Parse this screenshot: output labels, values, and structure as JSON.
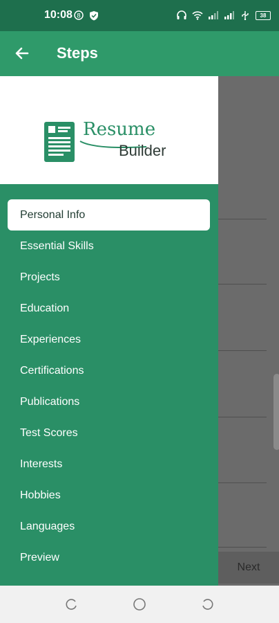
{
  "status": {
    "time": "10:08",
    "battery": "38"
  },
  "appbar": {
    "title": "Steps"
  },
  "drawer": {
    "logo": {
      "word1": "Resume",
      "word2": "Builder"
    },
    "items": [
      {
        "label": "Personal Info",
        "active": true
      },
      {
        "label": "Essential Skills"
      },
      {
        "label": "Projects"
      },
      {
        "label": "Education"
      },
      {
        "label": "Experiences"
      },
      {
        "label": "Certifications"
      },
      {
        "label": "Publications"
      },
      {
        "label": "Test Scores"
      },
      {
        "label": "Interests"
      },
      {
        "label": "Hobbies"
      },
      {
        "label": "Languages"
      },
      {
        "label": "Preview"
      }
    ]
  },
  "content": {
    "next_label": "Next"
  },
  "colors": {
    "primary": "#2f9a6a",
    "primary_dark": "#1e6f4d",
    "drawer": "#2a8f66"
  }
}
